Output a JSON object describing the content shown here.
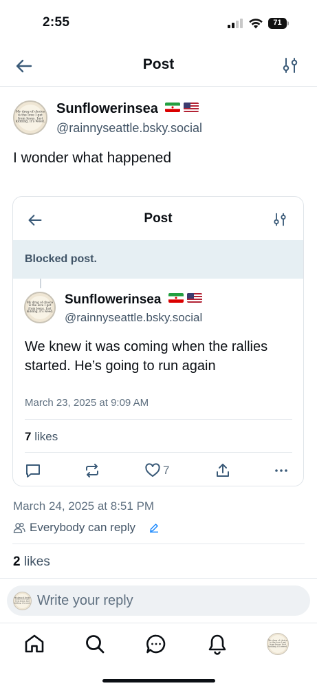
{
  "status_bar": {
    "time": "2:55",
    "battery": "71"
  },
  "header": {
    "title": "Post"
  },
  "post": {
    "author": {
      "display_name": "Sunflowerinsea",
      "flags": [
        "iran-flag",
        "us-flag"
      ],
      "handle": "@rainnyseattle.bsky.social",
      "avatar_text": "My drug of choice is the love I get from Jesus. Just kidding, it's weed."
    },
    "text": "I wonder what happened",
    "date": "March 24, 2025 at 8:51 PM",
    "reply_setting": "Everybody can reply",
    "likes_count": "2",
    "likes_label": "likes"
  },
  "embed": {
    "header_title": "Post",
    "blocked_label": "Blocked post.",
    "author": {
      "display_name": "Sunflowerinsea",
      "handle": "@rainnyseattle.bsky.social"
    },
    "text": "We knew it was coming when the rallies started. He’s going to run again",
    "date": "March 23, 2025 at 9:09 AM",
    "likes_count": "7",
    "likes_label": "likes",
    "like_action_count": "7"
  },
  "reply_bar": {
    "placeholder": "Write your reply"
  },
  "nav": {
    "items": [
      "home-icon",
      "search-icon",
      "chat-icon",
      "notifications-icon",
      "profile-avatar"
    ]
  },
  "colors": {
    "text": "#0b0f14",
    "muted": "#5f7080",
    "accent_link": "#1083fe",
    "blocked_bg": "#e6eff3",
    "icon": "#425466"
  }
}
